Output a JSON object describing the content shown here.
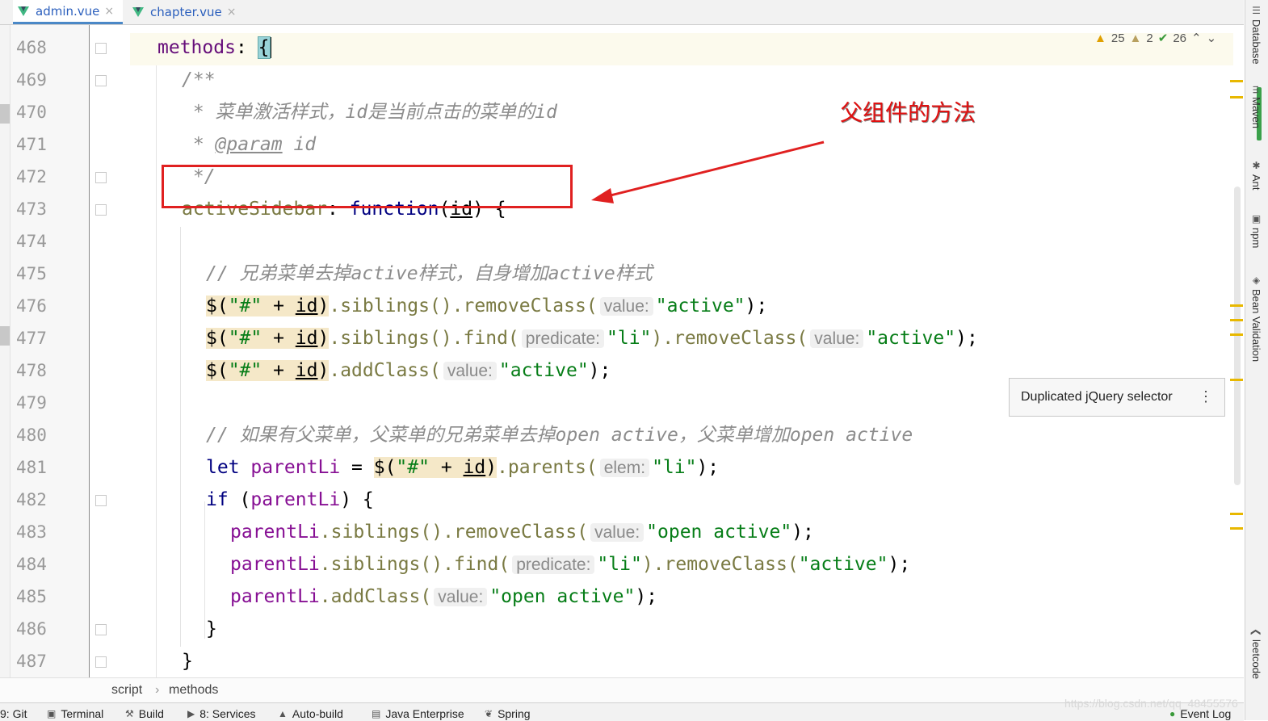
{
  "tabs": [
    {
      "label": "admin.vue",
      "active": true
    },
    {
      "label": "chapter.vue",
      "active": false
    }
  ],
  "inspections": {
    "warnings": "25",
    "weak_warnings": "2",
    "ok": "26"
  },
  "annotation": {
    "text": "父组件的方法",
    "color": "#e01010"
  },
  "tooltip": {
    "text": "Duplicated jQuery selector"
  },
  "line_numbers": [
    "468",
    "469",
    "470",
    "471",
    "472",
    "473",
    "474",
    "475",
    "476",
    "477",
    "478",
    "479",
    "480",
    "481",
    "482",
    "483",
    "484",
    "485",
    "486",
    "487"
  ],
  "code": {
    "l468": {
      "name": "methods",
      "colon": ": ",
      "brace": "{"
    },
    "l469": "/**",
    "l470": " * 菜单激活样式，id是当前点击的菜单的id",
    "l471": {
      "star": " * ",
      "tag": "@param",
      "rest": " id"
    },
    "l472": " */",
    "l473": {
      "name": "activeSidebar",
      "colon": ": ",
      "kw": "function",
      "open": "(",
      "param": "id",
      "close": ") {"
    },
    "l475": "// 兄弟菜单去掉active样式，自身增加active样式",
    "l476": {
      "sel_a": "$(",
      "sel_str": "\"#\"",
      "sel_plus": " + ",
      "sel_id": "id",
      "sel_b": ")",
      "m1": ".siblings().removeClass(",
      "hint": "value:",
      "arg": "\"active\"",
      "end": ");"
    },
    "l477": {
      "sel_a": "$(",
      "sel_str": "\"#\"",
      "sel_plus": " + ",
      "sel_id": "id",
      "sel_b": ")",
      "m1": ".siblings().find(",
      "hint1": "predicate:",
      "arg1": "\"li\"",
      "m2": ").removeClass(",
      "hint2": "value:",
      "arg2": "\"active\"",
      "end": ");"
    },
    "l478": {
      "sel_a": "$(",
      "sel_str": "\"#\"",
      "sel_plus": " + ",
      "sel_id": "id",
      "sel_b": ")",
      "m1": ".addClass(",
      "hint": "value:",
      "arg": "\"active\"",
      "end": ");"
    },
    "l480": "// 如果有父菜单，父菜单的兄弟菜单去掉open active，父菜单增加open active",
    "l481": {
      "kw": "let",
      "var": " parentLi",
      "eq": " = ",
      "sel_a": "$(",
      "sel_str": "\"#\"",
      "sel_plus": " + ",
      "sel_id": "id",
      "sel_b": ")",
      "m1": ".parents(",
      "hint": "elem:",
      "arg": "\"li\"",
      "end": ");"
    },
    "l482": {
      "kw": "if",
      "open": " (",
      "var": "parentLi",
      "close": ") {"
    },
    "l483": {
      "var": "parentLi",
      "m1": ".siblings().removeClass(",
      "hint": "value:",
      "arg": "\"open active\"",
      "end": ");"
    },
    "l484": {
      "var": "parentLi",
      "m1": ".siblings().find(",
      "hint": "predicate:",
      "arg": "\"li\"",
      "m2": ").removeClass(",
      "arg2": "\"active\"",
      "end": ");"
    },
    "l485": {
      "var": "parentLi",
      "m1": ".addClass(",
      "hint": "value:",
      "arg": "\"open active\"",
      "end": ");"
    },
    "l486": "}",
    "l487": "}"
  },
  "right_tools": [
    "Database",
    "Maven",
    "Ant",
    "npm",
    "Bean Validation",
    "leetcode"
  ],
  "breadcrumb": [
    "script",
    "methods"
  ],
  "status_bar": [
    "9: Git",
    "Terminal",
    "Build",
    "8: Services",
    "Auto-build",
    "Java Enterprise",
    "Spring",
    "Event Log"
  ],
  "watermark": "https://blog.csdn.net/qq_48455576"
}
